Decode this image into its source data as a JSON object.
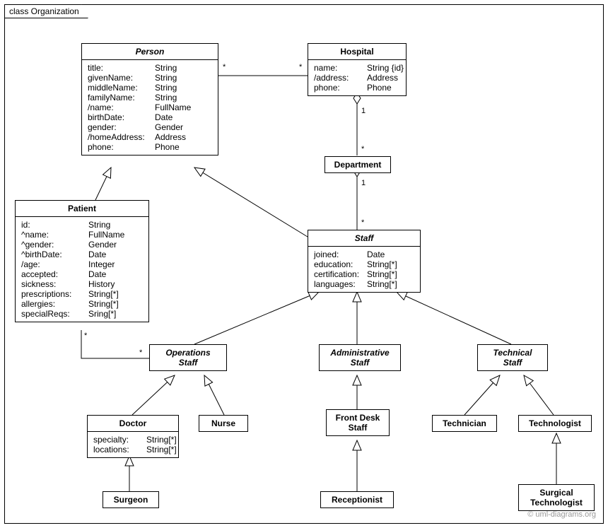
{
  "frameLabel": "class Organization",
  "watermark": "© uml-diagrams.org",
  "classes": {
    "person": {
      "name": "Person",
      "attrs": [
        [
          "title:",
          "String"
        ],
        [
          "givenName:",
          "String"
        ],
        [
          "middleName:",
          "String"
        ],
        [
          "familyName:",
          "String"
        ],
        [
          "/name:",
          "FullName"
        ],
        [
          "birthDate:",
          "Date"
        ],
        [
          "gender:",
          "Gender"
        ],
        [
          "/homeAddress:",
          "Address"
        ],
        [
          "phone:",
          "Phone"
        ]
      ]
    },
    "hospital": {
      "name": "Hospital",
      "attrs": [
        [
          "name:",
          "String {id}"
        ],
        [
          "/address:",
          "Address"
        ],
        [
          "phone:",
          "Phone"
        ]
      ]
    },
    "department": {
      "name": "Department"
    },
    "patient": {
      "name": "Patient",
      "attrs": [
        [
          "id:",
          "String"
        ],
        [
          "^name:",
          "FullName"
        ],
        [
          "^gender:",
          "Gender"
        ],
        [
          "^birthDate:",
          "Date"
        ],
        [
          "/age:",
          "Integer"
        ],
        [
          "accepted:",
          "Date"
        ],
        [
          "sickness:",
          "History"
        ],
        [
          "prescriptions:",
          "String[*]"
        ],
        [
          "allergies:",
          "String[*]"
        ],
        [
          "specialReqs:",
          "Sring[*]"
        ]
      ]
    },
    "staff": {
      "name": "Staff",
      "attrs": [
        [
          "joined:",
          "Date"
        ],
        [
          "education:",
          "String[*]"
        ],
        [
          "certification:",
          "String[*]"
        ],
        [
          "languages:",
          "String[*]"
        ]
      ]
    },
    "opsStaff": {
      "name": "Operations",
      "name2": "Staff"
    },
    "adminStaff": {
      "name": "Administrative",
      "name2": "Staff"
    },
    "techStaff": {
      "name": "Technical",
      "name2": "Staff"
    },
    "doctor": {
      "name": "Doctor",
      "attrs": [
        [
          "specialty:",
          "String[*]"
        ],
        [
          "locations:",
          "String[*]"
        ]
      ]
    },
    "nurse": {
      "name": "Nurse"
    },
    "frontDesk": {
      "name": "Front Desk",
      "name2": "Staff"
    },
    "technician": {
      "name": "Technician"
    },
    "technologist": {
      "name": "Technologist"
    },
    "surgeon": {
      "name": "Surgeon"
    },
    "receptionist": {
      "name": "Receptionist"
    },
    "surgTech": {
      "name": "Surgical",
      "name2": "Technologist"
    }
  },
  "multiplicities": {
    "personHospL": "*",
    "personHospR": "*",
    "hospDeptTop": "1",
    "hospDeptBot": "*",
    "deptStaffTop": "1",
    "deptStaffBot": "*",
    "patientOpsL": "*",
    "patientOpsR": "*"
  }
}
